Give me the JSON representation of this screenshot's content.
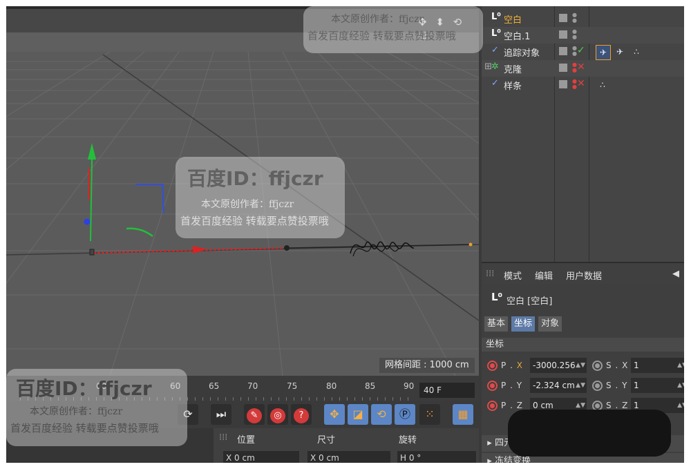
{
  "viewport": {
    "grid_spacing_label": "网格间距 : 1000 cm",
    "nav_icons": "✥ ⬍ ⟲ ◻"
  },
  "objects": [
    {
      "name": "空白",
      "icon": "L⁰",
      "selected": true
    },
    {
      "name": "空白.1",
      "icon": "L⁰",
      "selected": false
    },
    {
      "name": "追踪对象",
      "icon": "✓",
      "selected": false
    },
    {
      "name": "克隆",
      "icon": "✲",
      "selected": false
    },
    {
      "name": "样条",
      "icon": "✓",
      "selected": false
    }
  ],
  "attributes": {
    "menu": [
      "模式",
      "编辑",
      "用户数据"
    ],
    "title": "空白 [空白]",
    "tabs": [
      "基本",
      "坐标",
      "对象"
    ],
    "active_tab": "坐标",
    "section": "坐标",
    "rows": [
      {
        "p_label": "P",
        "p_axis": "X",
        "p_value": "-3000.256",
        "s_label": "S",
        "s_axis": "X",
        "s_value": "1"
      },
      {
        "p_label": "P",
        "p_axis": "Y",
        "p_value": "-2.324 cm",
        "s_label": "S",
        "s_axis": "Y",
        "s_value": "1"
      },
      {
        "p_label": "P",
        "p_axis": "Z",
        "p_value": "0 cm",
        "s_label": "S",
        "s_axis": "Z",
        "s_value": "1"
      }
    ],
    "collapsed": [
      "四元",
      "冻结变换"
    ]
  },
  "timeline": {
    "ticks": [
      "60",
      "65",
      "70",
      "75",
      "80",
      "85",
      "90"
    ],
    "end_frame": "40 F"
  },
  "coords_panel": {
    "headers": [
      "位置",
      "尺寸",
      "旋转"
    ],
    "fields": [
      "X  0 cm",
      "X  0 cm",
      "H  0 °"
    ]
  },
  "watermarks": {
    "big": "百度ID：ffjczr",
    "line1": "本文原创作者：ffjczr",
    "line2": "首发百度经验 转载要点赞投票哦",
    "bottom_big": "百度ID：ffjczr",
    "bottom_line1": "本文原创作者：ffjczr",
    "bottom_line2": "首发百度经验 转载要点赞投票哦",
    "top_line1": "本文原创作者：ffjczr",
    "top_line2": "首发百度经验 转载要点赞投票哦"
  },
  "colors": {
    "selected_text": "#f2b233",
    "accent_blue": "#5c86c6",
    "red_button": "#d33a3a",
    "x_axis": "#e02020",
    "y_axis": "#22c03a",
    "z_axis": "#3050e0"
  }
}
